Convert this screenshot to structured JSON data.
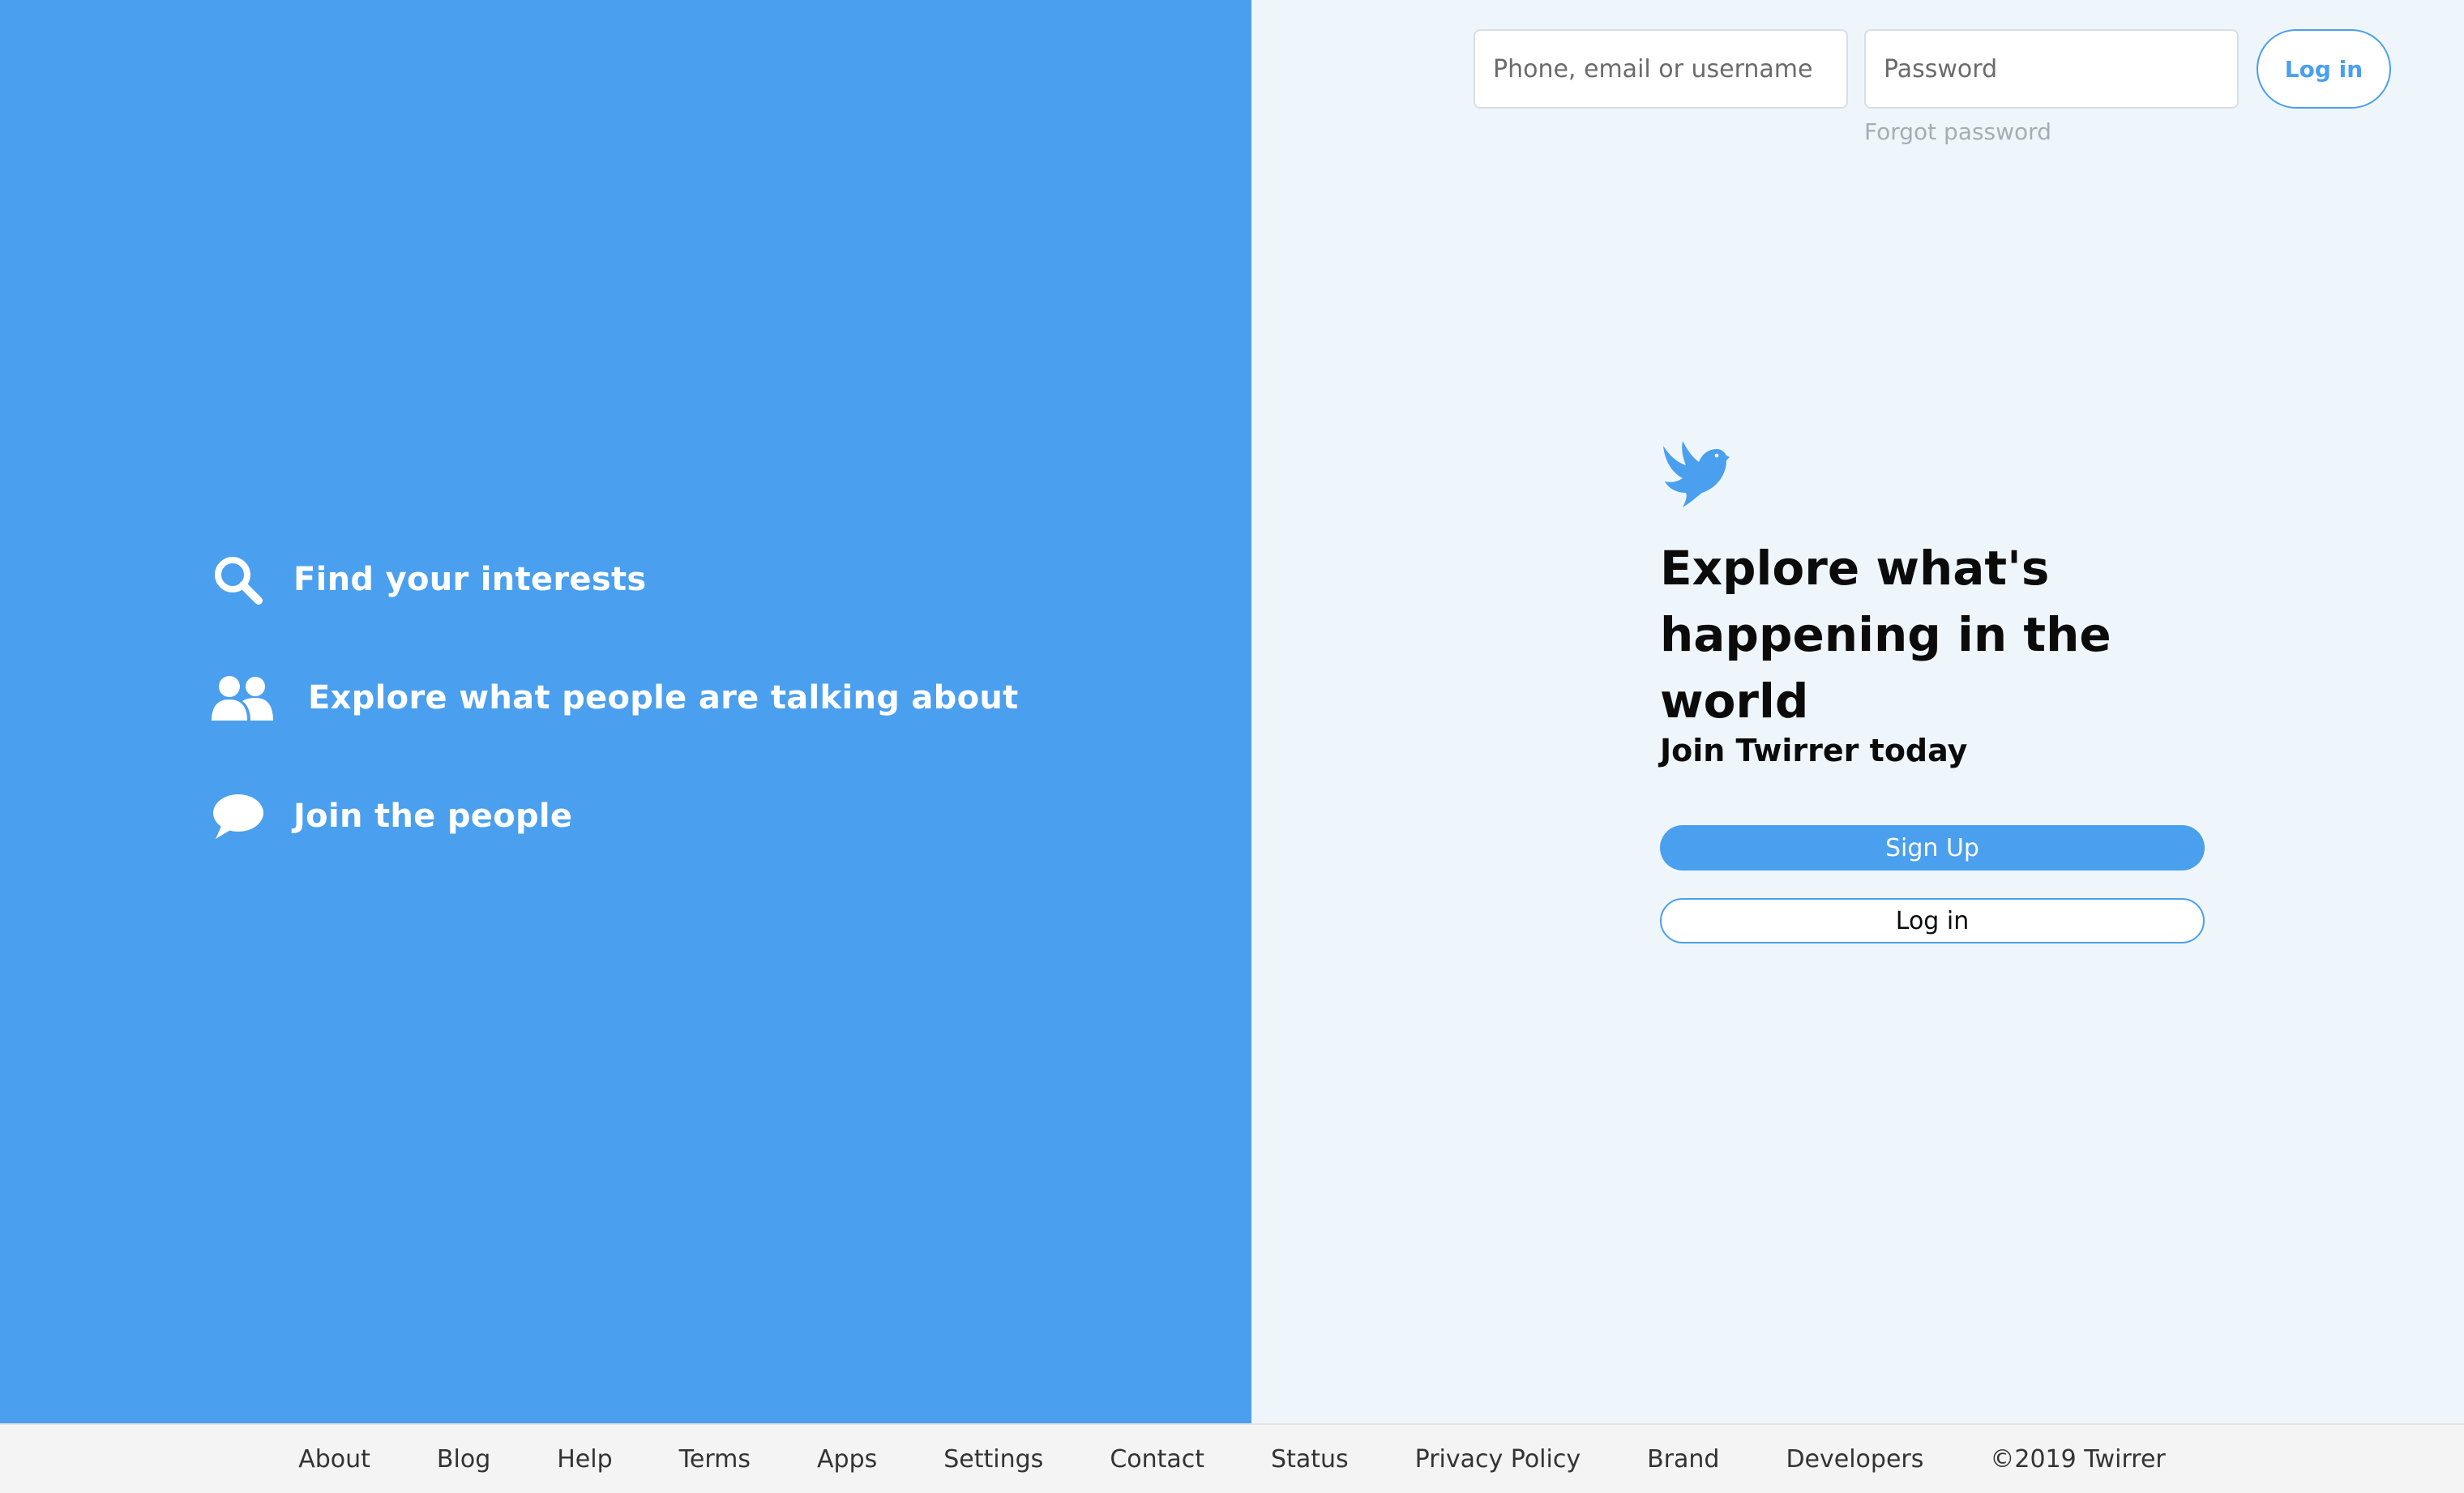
{
  "colors": {
    "brand_blue": "#4a9fee",
    "right_panel_bg": "#eff6fb",
    "footer_bg": "#f4f4f4"
  },
  "left_panel": {
    "features": [
      {
        "icon": "search-icon",
        "label": "Find your interests"
      },
      {
        "icon": "people-icon",
        "label": "Explore what people are talking about"
      },
      {
        "icon": "chat-bubble-icon",
        "label": "Join the people"
      }
    ]
  },
  "login_bar": {
    "username_placeholder": "Phone, email or username",
    "username_value": "",
    "password_placeholder": "Password",
    "password_value": "",
    "login_label": "Log in",
    "forgot_label": "Forgot password"
  },
  "main": {
    "logo_icon": "bird-icon",
    "headline": "Explore what's happening in the world",
    "join_heading": "Join Twirrer today",
    "signup_label": "Sign Up",
    "login_label": "Log in"
  },
  "footer": {
    "links": [
      "About",
      "Blog",
      "Help",
      "Terms",
      "Apps",
      "Settings",
      "Contact",
      "Status",
      "Privacy Policy",
      "Brand",
      "Developers"
    ],
    "copyright": "©2019 Twirrer"
  }
}
